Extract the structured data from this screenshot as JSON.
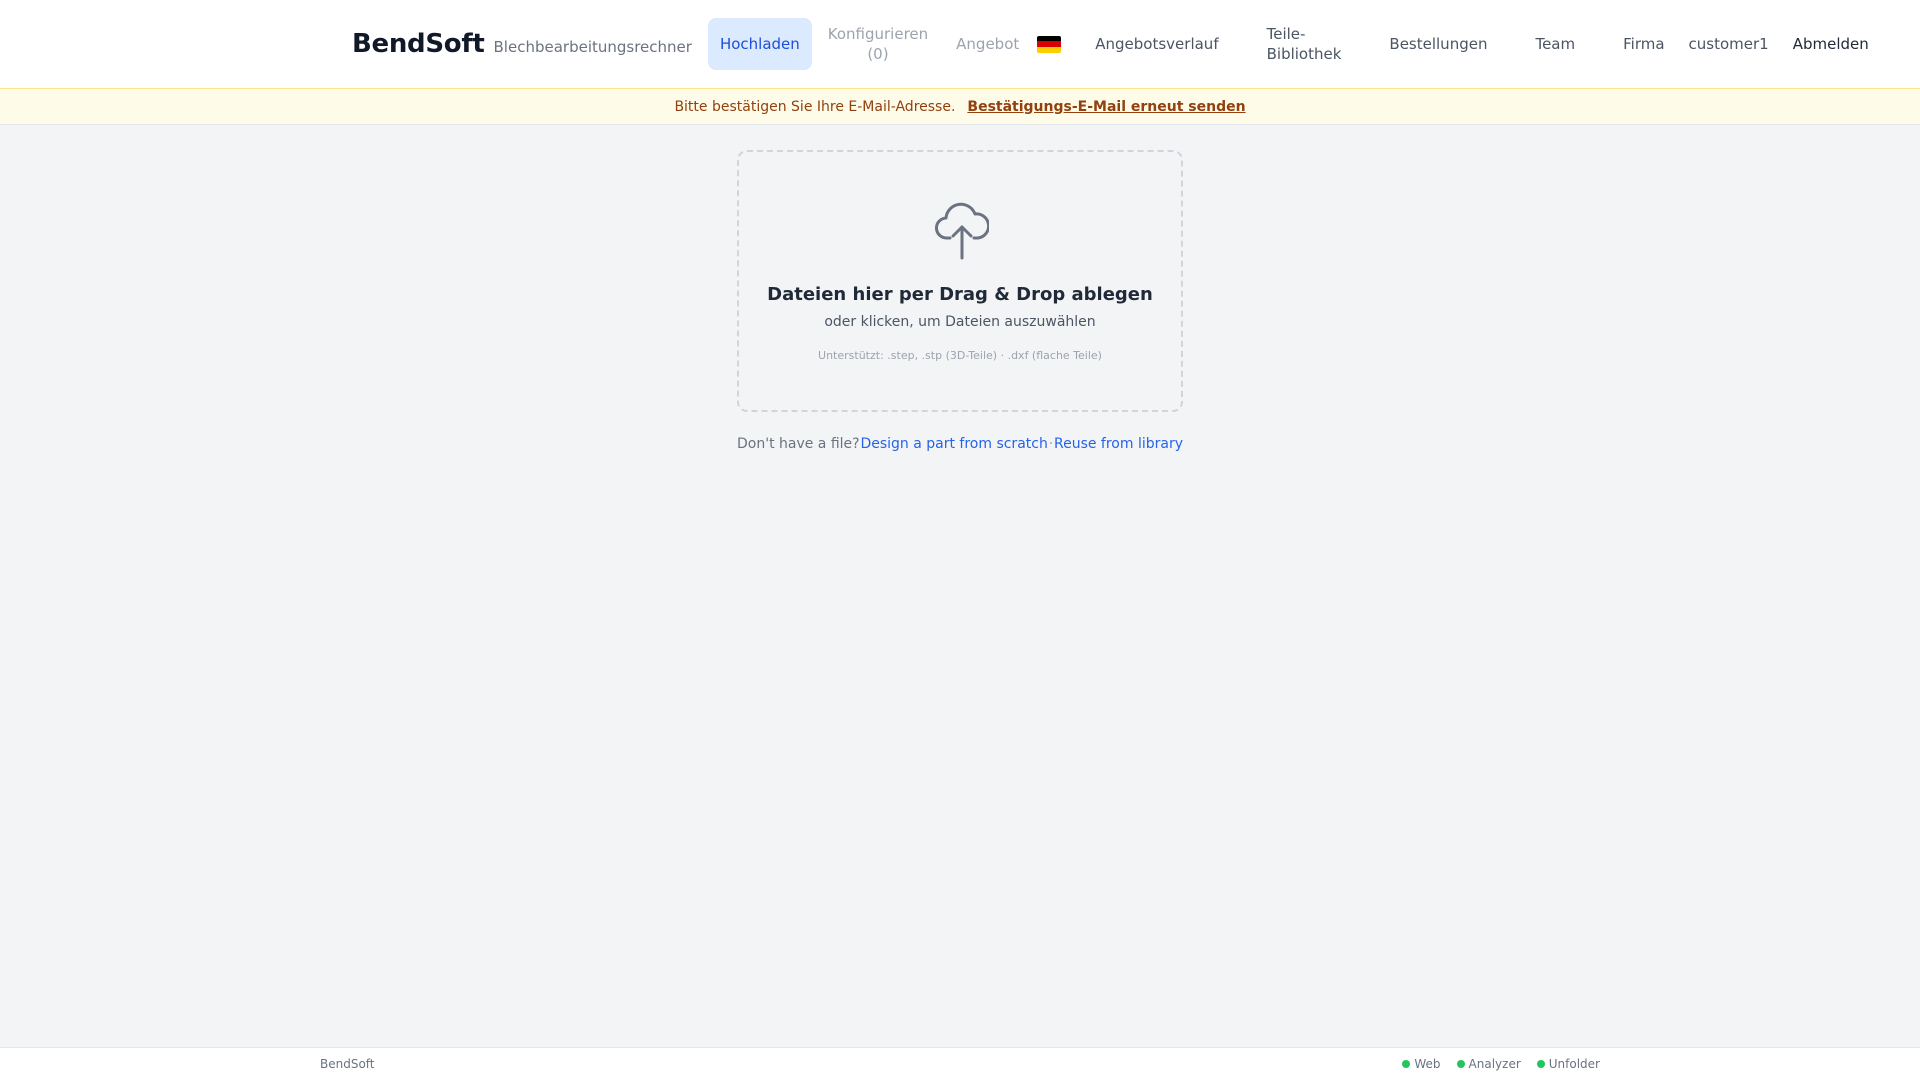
{
  "header": {
    "brand": "BendSoft",
    "subtitle": "Blechbearbeitungsrechner",
    "nav": {
      "upload": "Hochladen",
      "configure_line1": "Konfigurieren",
      "configure_line2": "(0)",
      "quote": "Angebot",
      "language_flag": "de-flag-icon",
      "quote_history": "Angebotsverlauf",
      "parts_library_line1": "Teile-",
      "parts_library_line2": "Bibliothek",
      "orders": "Bestellungen",
      "team": "Team",
      "company": "Firma",
      "user": "customer1",
      "logout": "Abmelden"
    }
  },
  "banner": {
    "text": "Bitte bestätigen Sie Ihre E-Mail-Adresse.",
    "link": "Bestätigungs-E-Mail erneut senden"
  },
  "dropzone": {
    "icon": "cloud-upload-icon",
    "title": "Dateien hier per Drag & Drop ablegen",
    "subtitle": "oder klicken, um Dateien auszuwählen",
    "hint": "Unterstützt: .step, .stp (3D-Teile) · .dxf (flache Teile)"
  },
  "alternatives": {
    "label": "Don't have a file?",
    "design_link": "Design a part from scratch",
    "separator": "·",
    "library_link": "Reuse from library"
  },
  "footer": {
    "brand": "BendSoft",
    "services": [
      "Web",
      "Analyzer",
      "Unfolder"
    ],
    "status_color": "#22c55e"
  },
  "colors": {
    "accent": "#2563eb",
    "active_nav_bg": "#dbeafe",
    "banner_bg": "#fefce8",
    "banner_text": "#92400e"
  }
}
